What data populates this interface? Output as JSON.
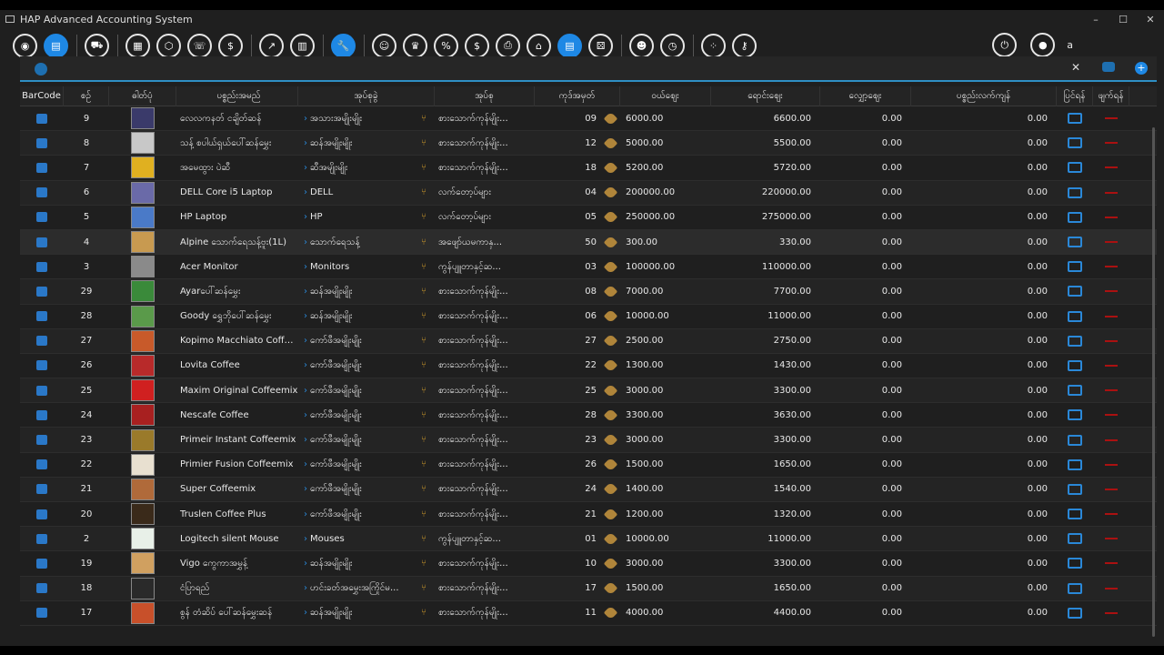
{
  "window": {
    "title": "HAP Advanced Accounting System",
    "controls": {
      "minimize": "–",
      "maximize": "☐",
      "close": "✕"
    }
  },
  "toolbar": {
    "groups": [
      [
        "dashboard-icon",
        "box-icon"
      ],
      [
        "cart-icon"
      ],
      [
        "document-icon",
        "cube-icon",
        "phone-icon",
        "money-icon"
      ],
      [
        "chart-line-icon",
        "chart-bar-icon"
      ],
      [
        "wrench-icon"
      ],
      [
        "team-icon",
        "trophy-icon",
        "percent-icon",
        "dollar-icon",
        "printer-icon",
        "store-icon",
        "inventory-icon",
        "dice-icon"
      ],
      [
        "user-icon",
        "clock-settings-icon"
      ],
      [
        "settings-dots-icon",
        "key-icon"
      ]
    ],
    "active": [
      "box-icon",
      "wrench-icon",
      "inventory-icon"
    ],
    "user_label": "a"
  },
  "search": {
    "placeholder": "",
    "clear": "✕",
    "add": "+"
  },
  "columns": {
    "barcode": "BarCode",
    "no": "စဉ်",
    "image": "ဓါတ်ပုံ",
    "name": "ပစ္စည်းအမည်",
    "category": "အုပ်စုခွဲ",
    "type": "အုပ်စု",
    "code": "ကုဒ်အမှတ်",
    "buy": "ဝယ်ဈေး",
    "sell": "ရောင်းဈေး",
    "discount": "လျှော့ဈေး",
    "stock": "ပစ္စည်းလက်ကျန်",
    "edit": "ပြင်ရန်",
    "delete": "ဖျက်ရန်"
  },
  "rows": [
    {
      "no": "9",
      "name": "လေလကနတ် ငချိတ်ဆန်",
      "category": "အသားအမျိုးမျိုး",
      "type": "စားသောက်ကုန်မျိုး...",
      "code": "09",
      "buy": "6000.00",
      "sell": "6600.00",
      "discount": "0.00",
      "stock": "0.00",
      "img": "#3a3a6a"
    },
    {
      "no": "8",
      "name": "သန့် စပါယ်ရှယ်ပေါ်ဆန်မွှေး",
      "category": "ဆန်အမျိုးမျိုး",
      "type": "စားသောက်ကုန်မျိုး...",
      "code": "12",
      "buy": "5000.00",
      "sell": "5500.00",
      "discount": "0.00",
      "stock": "0.00",
      "img": "#c8c8c8"
    },
    {
      "no": "7",
      "name": "အမေထွား ပဲဆီ",
      "category": "ဆီအမျိုးမျိုး",
      "type": "စားသောက်ကုန်မျိုး...",
      "code": "18",
      "buy": "5200.00",
      "sell": "5720.00",
      "discount": "0.00",
      "stock": "0.00",
      "img": "#e0b020"
    },
    {
      "no": "6",
      "name": "DELL Core i5 Laptop",
      "category": "DELL",
      "type": "လက်တော့ပ်များ",
      "code": "04",
      "buy": "200000.00",
      "sell": "220000.00",
      "discount": "0.00",
      "stock": "0.00",
      "img": "#6a6aa8"
    },
    {
      "no": "5",
      "name": "HP Laptop",
      "category": "HP",
      "type": "လက်တော့ပ်များ",
      "code": "05",
      "buy": "250000.00",
      "sell": "275000.00",
      "discount": "0.00",
      "stock": "0.00",
      "img": "#4a7ac8"
    },
    {
      "no": "4",
      "name": "Alpine သောက်ရေသန့်ဗူး(1L)",
      "category": "သောက်ရေသန့်",
      "type": "အဖျော်ယမကာနှ...",
      "code": "50",
      "buy": "300.00",
      "sell": "330.00",
      "discount": "0.00",
      "stock": "0.00",
      "img": "#c89a50"
    },
    {
      "no": "3",
      "name": "Acer Monitor",
      "category": "Monitors",
      "type": "ကွန်ပျူတာနှင့်ဆ...",
      "code": "03",
      "buy": "100000.00",
      "sell": "110000.00",
      "discount": "0.00",
      "stock": "0.00",
      "img": "#8a8a8a"
    },
    {
      "no": "29",
      "name": "Ayarပေါ်ဆန်မွှေး",
      "category": "ဆန်အမျိုးမျိုး",
      "type": "စားသောက်ကုန်မျိုး...",
      "code": "08",
      "buy": "7000.00",
      "sell": "7700.00",
      "discount": "0.00",
      "stock": "0.00",
      "img": "#3a8a3a"
    },
    {
      "no": "28",
      "name": "Goody ရွှေဘိုပေါ်ဆန်မွှေး",
      "category": "ဆန်အမျိုးမျိုး",
      "type": "စားသောက်ကုန်မျိုး...",
      "code": "06",
      "buy": "10000.00",
      "sell": "11000.00",
      "discount": "0.00",
      "stock": "0.00",
      "img": "#5a9a4a"
    },
    {
      "no": "27",
      "name": "Kopimo Macchiato Coffe...",
      "category": "ကော်ဖီအမျိုးမျိုး",
      "type": "စားသောက်ကုန်မျိုး...",
      "code": "27",
      "buy": "2500.00",
      "sell": "2750.00",
      "discount": "0.00",
      "stock": "0.00",
      "img": "#c85a2a"
    },
    {
      "no": "26",
      "name": "Lovita Coffee",
      "category": "ကော်ဖီအမျိုးမျိုး",
      "type": "စားသောက်ကုန်မျိုး...",
      "code": "22",
      "buy": "1300.00",
      "sell": "1430.00",
      "discount": "0.00",
      "stock": "0.00",
      "img": "#b82a2a"
    },
    {
      "no": "25",
      "name": "Maxim Original Coffeemix",
      "category": "ကော်ဖီအမျိုးမျိုး",
      "type": "စားသောက်ကုန်မျိုး...",
      "code": "25",
      "buy": "3000.00",
      "sell": "3300.00",
      "discount": "0.00",
      "stock": "0.00",
      "img": "#d02020"
    },
    {
      "no": "24",
      "name": "Nescafe Coffee",
      "category": "ကော်ဖီအမျိုးမျိုး",
      "type": "စားသောက်ကုန်မျိုး...",
      "code": "28",
      "buy": "3300.00",
      "sell": "3630.00",
      "discount": "0.00",
      "stock": "0.00",
      "img": "#a82020"
    },
    {
      "no": "23",
      "name": "Primeir Instant Coffeemix",
      "category": "ကော်ဖီအမျိုးမျိုး",
      "type": "စားသောက်ကုန်မျိုး...",
      "code": "23",
      "buy": "3000.00",
      "sell": "3300.00",
      "discount": "0.00",
      "stock": "0.00",
      "img": "#9a7a2a"
    },
    {
      "no": "22",
      "name": "Primier Fusion Coffeemix",
      "category": "ကော်ဖီအမျိုးမျိုး",
      "type": "စားသောက်ကုန်မျိုး...",
      "code": "26",
      "buy": "1500.00",
      "sell": "1650.00",
      "discount": "0.00",
      "stock": "0.00",
      "img": "#e8e0d0"
    },
    {
      "no": "21",
      "name": "Super Coffeemix",
      "category": "ကော်ဖီအမျိုးမျိုး",
      "type": "စားသောက်ကုန်မျိုး...",
      "code": "24",
      "buy": "1400.00",
      "sell": "1540.00",
      "discount": "0.00",
      "stock": "0.00",
      "img": "#b06a3a"
    },
    {
      "no": "20",
      "name": "Truslen Coffee Plus",
      "category": "ကော်ဖီအမျိုးမျိုး",
      "type": "စားသောက်ကုန်မျိုး...",
      "code": "21",
      "buy": "1200.00",
      "sell": "1320.00",
      "discount": "0.00",
      "stock": "0.00",
      "img": "#3a2a1a"
    },
    {
      "no": "2",
      "name": "Logitech silent Mouse",
      "category": "Mouses",
      "type": "ကွန်ပျူတာနှင့်ဆ...",
      "code": "01",
      "buy": "10000.00",
      "sell": "11000.00",
      "discount": "0.00",
      "stock": "0.00",
      "img": "#e8f0e8"
    },
    {
      "no": "19",
      "name": "Vigo ကွေကာအမွှန့်",
      "category": "ဆန်အမျိုးမျိုး",
      "type": "စားသောက်ကုန်မျိုး...",
      "code": "10",
      "buy": "3000.00",
      "sell": "3300.00",
      "discount": "0.00",
      "stock": "0.00",
      "img": "#d0a060"
    },
    {
      "no": "18",
      "name": "ငံပြာရည်",
      "category": "ဟင်းခတ်အမွှေးအကြိုင်မ...",
      "type": "စားသောက်ကုန်မျိုး...",
      "code": "17",
      "buy": "1500.00",
      "sell": "1650.00",
      "discount": "0.00",
      "stock": "0.00",
      "img": "#2a2a2a"
    },
    {
      "no": "17",
      "name": "စွန် တံဆိပ် ပေါ်ဆန်မွှေးဆန်",
      "category": "ဆန်အမျိုးမျိုး",
      "type": "စားသောက်ကုန်မျိုး...",
      "code": "11",
      "buy": "4000.00",
      "sell": "4400.00",
      "discount": "0.00",
      "stock": "0.00",
      "img": "#c8502a"
    }
  ]
}
